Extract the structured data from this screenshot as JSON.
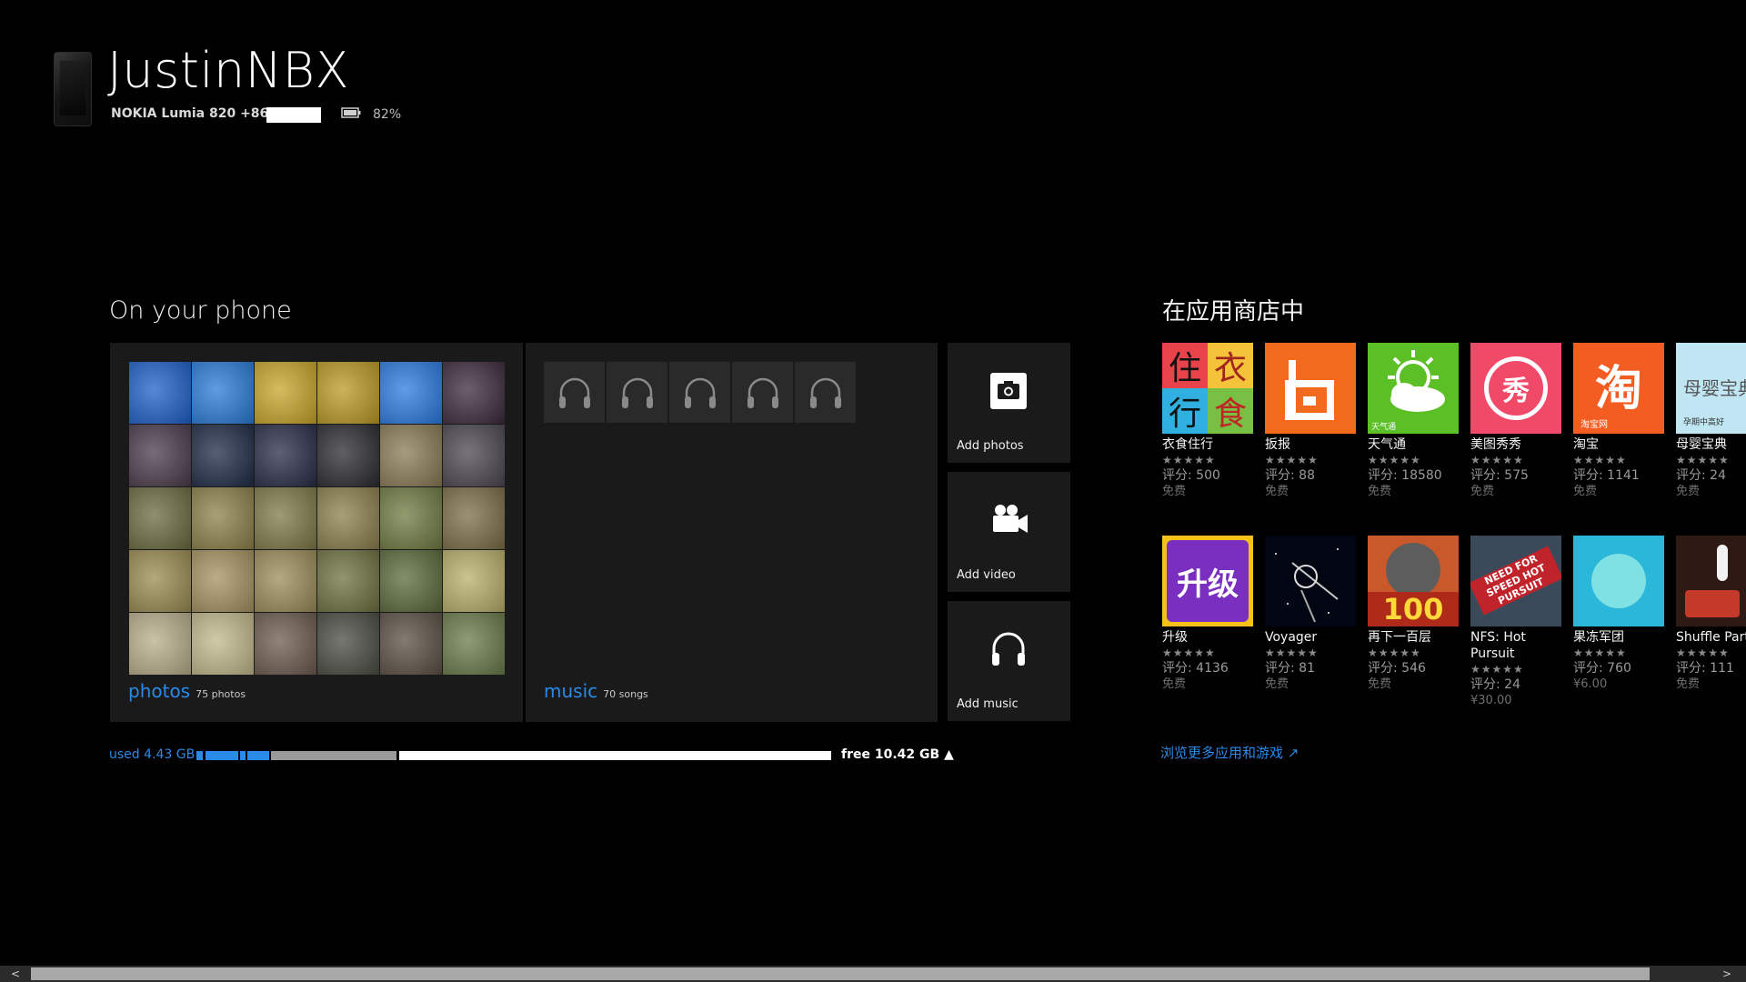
{
  "header": {
    "device_name": "JustinNBX",
    "device_model": "NOKIA Lumia 820 +86186",
    "battery": "82%"
  },
  "on_phone": {
    "title": "On your phone",
    "photos_label": "photos",
    "photos_count": "75 photos",
    "music_label": "music",
    "music_count": "70 songs",
    "add_photos": "Add photos",
    "add_video": "Add video",
    "add_music": "Add music"
  },
  "storage": {
    "used": "used 4.43 GB",
    "free": "free 10.42 GB",
    "free_arrow": "▲"
  },
  "store": {
    "title": "在应用商店中",
    "browse_more": "浏览更多应用和游戏 ↗",
    "apps": [
      {
        "name": "衣食住行",
        "stars": "★★★★★",
        "rating": "评分: 500",
        "price": "免费"
      },
      {
        "name": "扳报",
        "stars": "★★★★★",
        "rating": "评分: 88",
        "price": "免费"
      },
      {
        "name": "天气通",
        "stars": "★★★★★",
        "rating": "评分: 18580",
        "price": "免费"
      },
      {
        "name": "美图秀秀",
        "stars": "★★★★★",
        "rating": "评分: 575",
        "price": "免费"
      },
      {
        "name": "淘宝",
        "stars": "★★★★★",
        "rating": "评分: 1141",
        "price": "免费"
      },
      {
        "name": "母婴宝典",
        "stars": "★★★★★",
        "rating": "评分: 24",
        "price": "免费"
      },
      {
        "name": "升级",
        "stars": "★★★★★",
        "rating": "评分: 4136",
        "price": "免费"
      },
      {
        "name": "Voyager",
        "stars": "★★★★★",
        "rating": "评分: 81",
        "price": "免费"
      },
      {
        "name": "再下一百层",
        "stars": "★★★★★",
        "rating": "评分: 546",
        "price": "免费"
      },
      {
        "name": "NFS: Hot Pursuit",
        "stars": "★★★★★",
        "rating": "评分: 24",
        "price": "¥30.00"
      },
      {
        "name": "果冻军团",
        "stars": "★★★★★",
        "rating": "评分: 760",
        "price": "¥6.00"
      },
      {
        "name": "Shuffle Party",
        "stars": "★★★★★",
        "rating": "评分: 111",
        "price": "免费"
      }
    ],
    "tile_text": {
      "yishi": [
        "住",
        "衣",
        "行",
        "食"
      ],
      "tianqi_sub": "天气通",
      "meitu": "秀",
      "taobao": "淘",
      "taobao_sub": "淘宝网",
      "muying": "母婴宝典",
      "muying_sub": "孕期中高好",
      "shengji": "升级",
      "hundred": "100",
      "nfs": "NEED FOR SPEED HOT PURSUIT"
    }
  },
  "colors": {
    "accent": "#2a8ae8",
    "tile_bg": "#1a1a1a"
  }
}
